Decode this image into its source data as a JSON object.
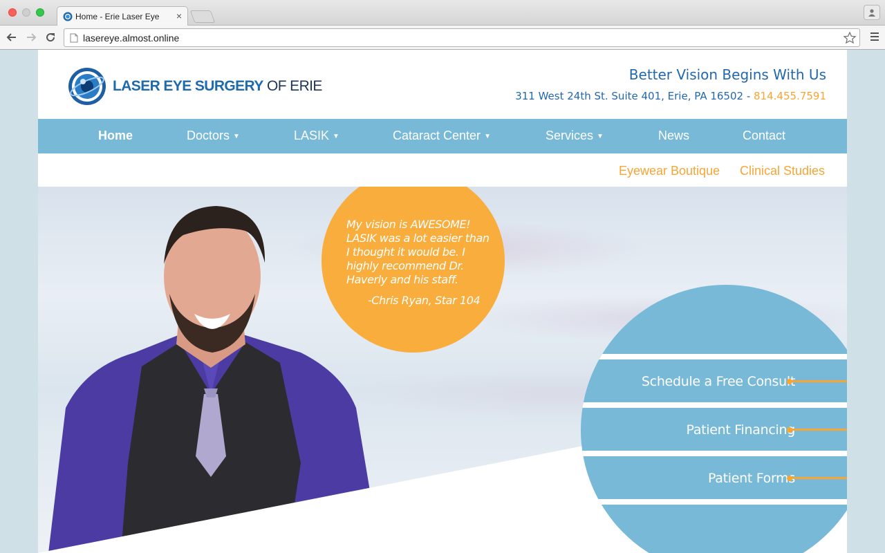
{
  "browser": {
    "tab_title": "Home - Erie Laser Eye",
    "tab_close": "×",
    "url": "lasereye.almost.online"
  },
  "site": {
    "logo_bold": "LASER EYE SURGERY",
    "logo_thin": "OF ERIE",
    "tagline": "Better Vision Begins With Us",
    "address": "311 West 24th St. Suite 401, Erie, PA 16502 - ",
    "phone": "814.455.7591"
  },
  "nav": {
    "home": "Home",
    "doctors": "Doctors",
    "lasik": "LASIK",
    "cataract": "Cataract Center",
    "services": "Services",
    "news": "News",
    "contact": "Contact"
  },
  "subnav": {
    "eyewear": "Eyewear Boutique",
    "clinical": "Clinical Studies"
  },
  "hero": {
    "quote": "My vision is AWESOME! LASIK was a lot easier than I thought it would be. I highly recommend Dr. Haverly and his staff.",
    "author": "-Chris Ryan, Star 104"
  },
  "cta": {
    "consult": "Schedule a Free Consult",
    "financing": "Patient Financing",
    "forms": "Patient Forms"
  },
  "colors": {
    "brand_blue": "#2367ad",
    "nav_blue": "#78b9d8",
    "accent_orange": "#f7a535"
  }
}
